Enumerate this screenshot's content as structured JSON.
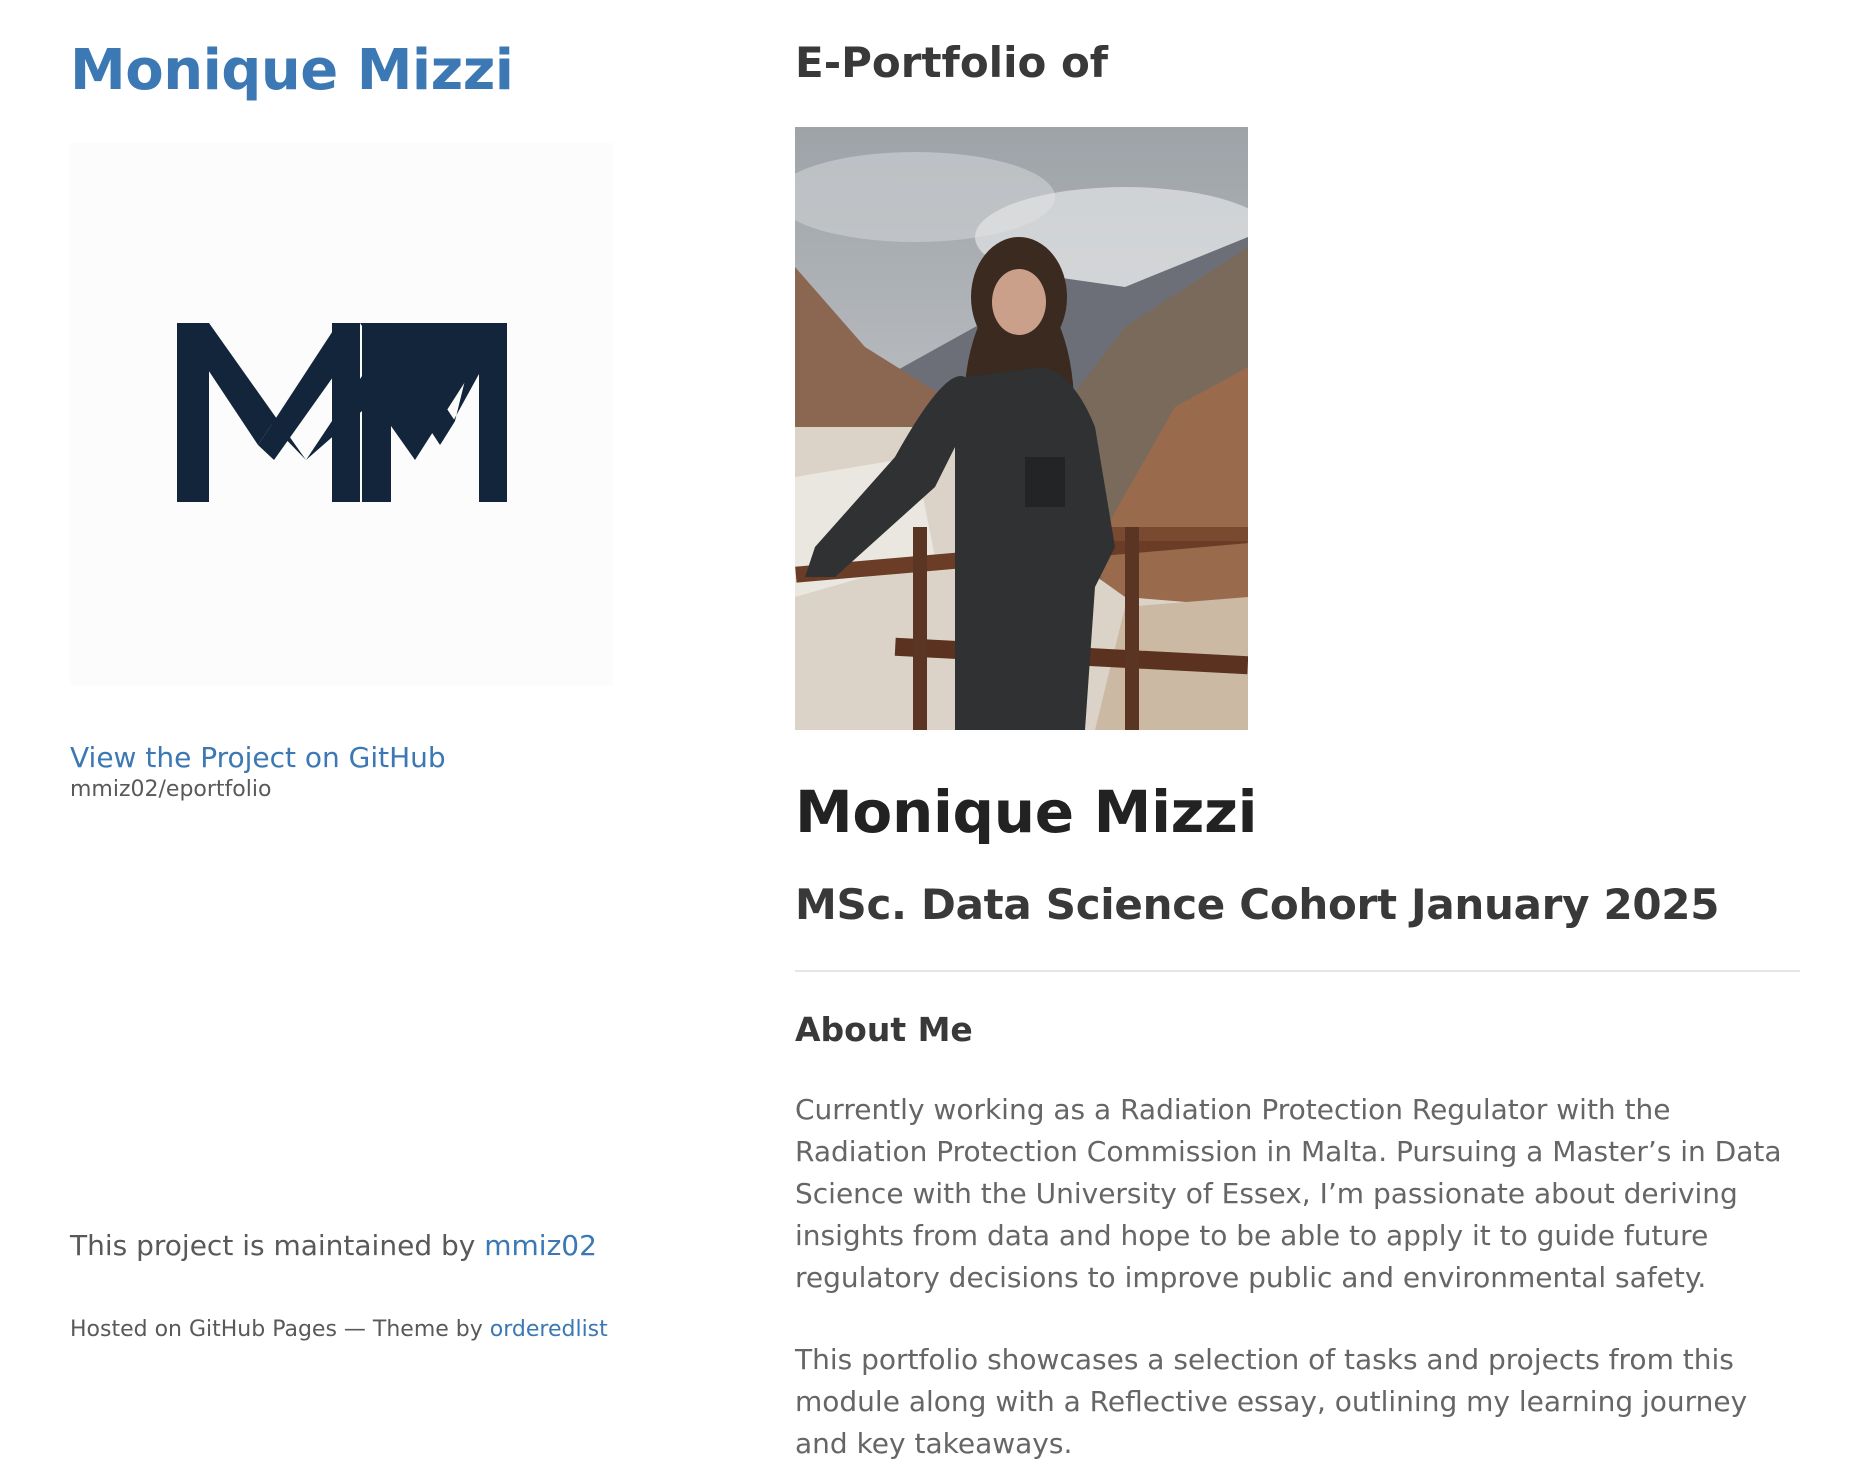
{
  "header": {
    "site_title": "Monique Mizzi",
    "logo_text": "MM",
    "github_link_label": "View the Project on GitHub",
    "github_repo": "mmiz02/eportfolio",
    "maintained_prefix": "This project is maintained by",
    "maintainer_link": "mmiz02",
    "hosted_prefix": "Hosted on GitHub Pages — Theme by",
    "theme_link": "orderedlist"
  },
  "main": {
    "eyebrow": "E-Portfolio of",
    "photo_icon": "profile-photo",
    "name_heading": "Monique Mizzi",
    "subtitle": "MSc. Data Science Cohort January 2025",
    "about_heading": "About Me",
    "about_paragraph_1": "Currently working as a Radiation Protection Regulator with the Radiation Protection Commission in Malta. Pursuing a Master’s in Data Science with the University of Essex, I’m passionate about deriving insights from data and hope to be able to apply it to guide future regulatory decisions to improve public and environmental safety.",
    "about_paragraph_2": "This portfolio showcases a selection of tasks and projects from this module along with a Reflective essay, outlining my learning journey and key takeaways."
  },
  "colors": {
    "link": "#3b78b4",
    "logo": "#12253a",
    "body_text": "#666666",
    "heading": "#393939"
  }
}
